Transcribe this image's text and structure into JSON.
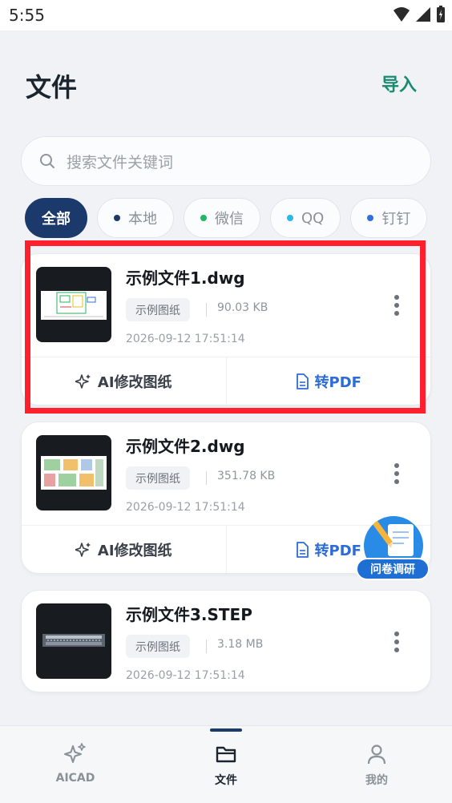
{
  "status_bar": {
    "time": "5:55"
  },
  "header": {
    "title": "文件",
    "import_label": "导入"
  },
  "search": {
    "placeholder": "搜索文件关键词"
  },
  "filters": [
    {
      "label": "全部",
      "active": true
    },
    {
      "label": "本地",
      "dot_color": "#1b3a6b"
    },
    {
      "label": "微信",
      "dot_color": "#22b566"
    },
    {
      "label": "QQ",
      "dot_color": "#2bb7e8"
    },
    {
      "label": "钉钉",
      "dot_color": "#2f6fe0"
    }
  ],
  "files": [
    {
      "name": "示例文件1.dwg",
      "tag": "示例图纸",
      "size": "90.03 KB",
      "date": "2026-09-12 17:51:14",
      "ai_action": "AI修改图纸",
      "pdf_action": "转PDF"
    },
    {
      "name": "示例文件2.dwg",
      "tag": "示例图纸",
      "size": "351.78 KB",
      "date": "2026-09-12 17:51:14",
      "ai_action": "AI修改图纸",
      "pdf_action": "转PDF"
    },
    {
      "name": "示例文件3.STEP",
      "tag": "示例图纸",
      "size": "3.18 MB",
      "date": "2026-09-12 17:51:14"
    }
  ],
  "survey": {
    "label": "问卷调研"
  },
  "bottom_nav": [
    {
      "label": "AICAD",
      "icon": "sparkle-icon"
    },
    {
      "label": "文件",
      "icon": "folder-icon",
      "active": true
    },
    {
      "label": "我的",
      "icon": "person-icon"
    }
  ],
  "colors": {
    "accent": "#1b3a6b",
    "import": "#1a8a72",
    "pdf_action": "#2d6bd6",
    "highlight": "#ff1f2d"
  }
}
